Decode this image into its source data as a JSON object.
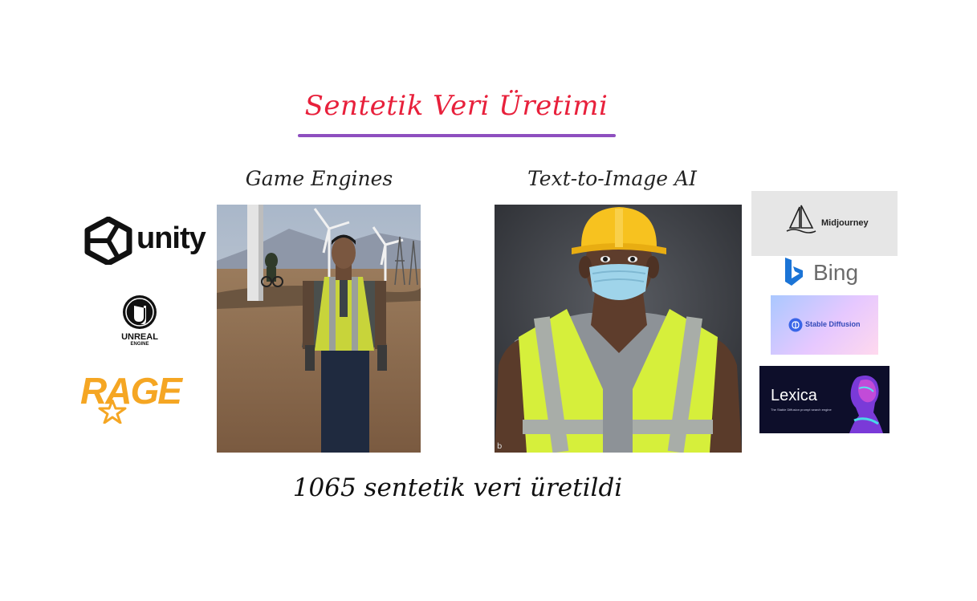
{
  "slide": {
    "title": "Sentetik Veri Üretimi",
    "footer": "1065 sentetik veri üretildi"
  },
  "left": {
    "heading": "Game Engines",
    "logos": {
      "unity": "unity",
      "unreal_line1": "UNREAL",
      "unreal_line2": "ENGINE",
      "rage": "RAGE"
    }
  },
  "right": {
    "heading": "Text-to-Image AI",
    "logos": {
      "midjourney": "Midjourney",
      "bing": "Bing",
      "stable_diffusion": "Stable Diffusion",
      "lexica": "Lexica",
      "lexica_tagline": "The Stable Diffusion prompt search engine"
    }
  },
  "colors": {
    "title": "#e8203b",
    "underline": "#8e4fbf",
    "rage": "#f5a623",
    "bing": "#1b74d6"
  }
}
